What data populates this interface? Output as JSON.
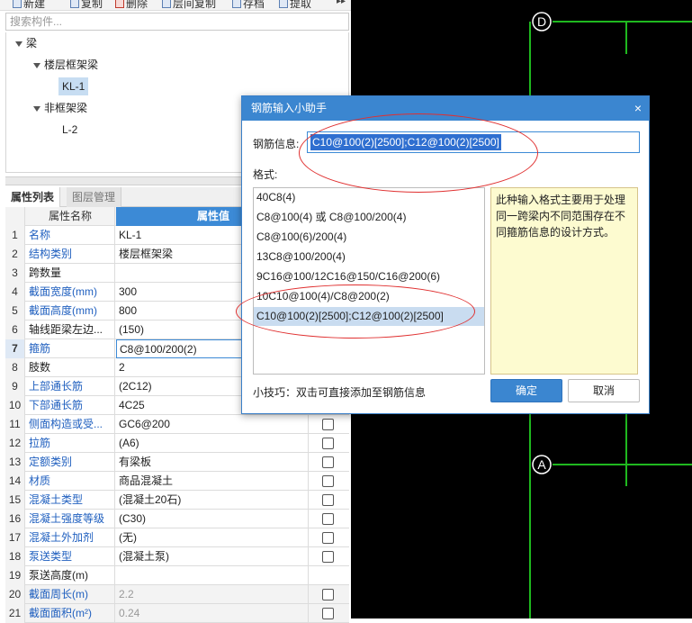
{
  "toolbar": {
    "items": [
      {
        "label": "新建"
      },
      {
        "label": "复制"
      },
      {
        "label": "删除"
      },
      {
        "label": "层间复制"
      },
      {
        "label": "存档"
      },
      {
        "label": "提取"
      }
    ]
  },
  "search": {
    "placeholder": "搜索构件..."
  },
  "tree": {
    "root": "梁",
    "group1": "楼层框架梁",
    "item1": "KL-1",
    "group2": "非框架梁",
    "item2": "L-2"
  },
  "tabs": {
    "properties": "属性列表",
    "layers": "图层管理"
  },
  "table": {
    "header_name": "属性名称",
    "header_value": "属性值",
    "rows": [
      {
        "num": "1",
        "name": "名称",
        "value": "KL-1"
      },
      {
        "num": "2",
        "name": "结构类别",
        "value": "楼层框架梁"
      },
      {
        "num": "3",
        "name": "跨数量",
        "value": ""
      },
      {
        "num": "4",
        "name": "截面宽度(mm)",
        "value": "300"
      },
      {
        "num": "5",
        "name": "截面高度(mm)",
        "value": "800"
      },
      {
        "num": "6",
        "name": "轴线距梁左边...",
        "value": "(150)"
      },
      {
        "num": "7",
        "name": "箍筋",
        "value": "C8@100/200(2)"
      },
      {
        "num": "8",
        "name": "肢数",
        "value": "2"
      },
      {
        "num": "9",
        "name": "上部通长筋",
        "value": "(2C12)"
      },
      {
        "num": "10",
        "name": "下部通长筋",
        "value": "4C25"
      },
      {
        "num": "11",
        "name": "侧面构造或受...",
        "value": "GC6@200"
      },
      {
        "num": "12",
        "name": "拉筋",
        "value": "(A6)"
      },
      {
        "num": "13",
        "name": "定额类别",
        "value": "有梁板"
      },
      {
        "num": "14",
        "name": "材质",
        "value": "商品混凝土"
      },
      {
        "num": "15",
        "name": "混凝土类型",
        "value": "(混凝土20石)"
      },
      {
        "num": "16",
        "name": "混凝土强度等级",
        "value": "(C30)"
      },
      {
        "num": "17",
        "name": "混凝土外加剂",
        "value": "(无)"
      },
      {
        "num": "18",
        "name": "泵送类型",
        "value": "(混凝土泵)"
      },
      {
        "num": "19",
        "name": "泵送高度(m)",
        "value": ""
      },
      {
        "num": "20",
        "name": "截面周长(m)",
        "value": "2.2"
      },
      {
        "num": "21",
        "name": "截面面积(m²)",
        "value": "0.24"
      }
    ]
  },
  "canvas": {
    "axis_top": "D",
    "axis_bottom": "A"
  },
  "dialog": {
    "title": "钢筋输入小助手",
    "close": "×",
    "info_label": "钢筋信息:",
    "info_value": "C10@100(2)[2500];C12@100(2)[2500]",
    "format_label": "格式:",
    "formats": [
      "40C8(4)",
      "C8@100(4) 或 C8@100/200(4)",
      "C8@100(6)/200(4)",
      "13C8@100/200(4)",
      "9C16@100/12C16@150/C16@200(6)",
      "10C10@100(4)/C8@200(2)",
      "C10@100(2)[2500];C12@100(2)[2500]"
    ],
    "note": "此种输入格式主要用于处理同一跨梁内不同范围存在不同箍筋信息的设计方式。",
    "tip": "小技巧：双击可直接添加至钢筋信息",
    "ok": "确定",
    "cancel": "取消"
  },
  "colors": {
    "accent": "#3b86d0",
    "annotation": "#e03030",
    "grid": "#1fb81f"
  }
}
